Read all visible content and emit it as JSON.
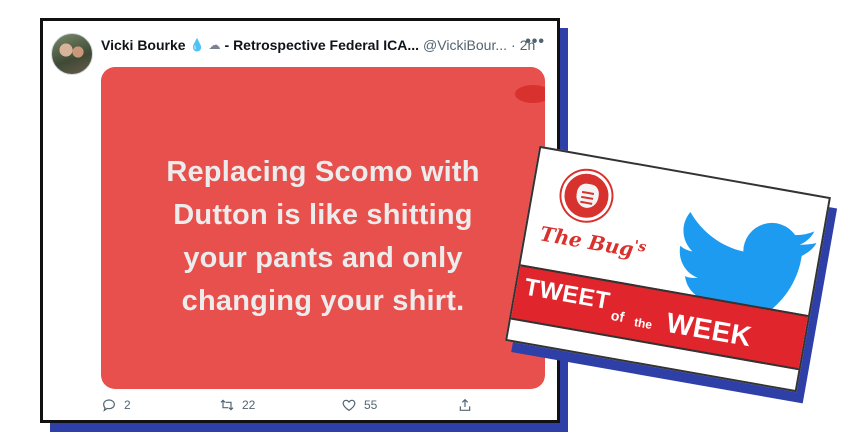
{
  "tweet": {
    "display_name": "Vicki Bourke",
    "emoji_1": "💧",
    "emoji_2": "☁",
    "name_suffix": "- Retrospective Federal ICA...",
    "handle": "@VickiBour...",
    "dot": "·",
    "time": "2h",
    "more": "•••",
    "media_text_lines": [
      "Replacing Scomo with",
      "Dutton is like shitting",
      "your pants and only",
      "changing your shirt."
    ],
    "replies": "2",
    "retweets": "22",
    "likes": "55"
  },
  "badge": {
    "title": "The Bug",
    "title_suffix": "'s",
    "banner_tweet": "TWEET",
    "banner_of": "of",
    "banner_the": "the",
    "banner_week": "WEEK"
  },
  "colors": {
    "media_background": "#e7504c",
    "brand_red": "#d8322f",
    "twitter_blue": "#1d9bf0",
    "shadow_blue": "#2f3fa8"
  },
  "icons": {
    "reply": "reply-icon",
    "retweet": "retweet-icon",
    "like": "heart-icon",
    "share": "share-icon",
    "more": "more-icon",
    "bird": "twitter-bird-icon"
  }
}
